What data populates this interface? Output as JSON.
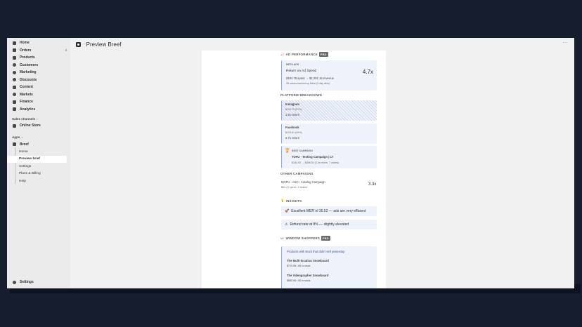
{
  "sidebar": {
    "nav": [
      {
        "label": "Home",
        "icon": "home-icon"
      },
      {
        "label": "Orders",
        "icon": "orders-icon",
        "badge": "4"
      },
      {
        "label": "Products",
        "icon": "products-icon"
      },
      {
        "label": "Customers",
        "icon": "customers-icon"
      },
      {
        "label": "Marketing",
        "icon": "marketing-icon"
      },
      {
        "label": "Discounts",
        "icon": "discounts-icon"
      },
      {
        "label": "Content",
        "icon": "content-icon"
      },
      {
        "label": "Markets",
        "icon": "markets-icon"
      },
      {
        "label": "Finance",
        "icon": "finance-icon"
      },
      {
        "label": "Analytics",
        "icon": "analytics-icon"
      }
    ],
    "sales_channels_label": "Sales channels",
    "online_store": "Online Store",
    "apps_label": "Apps",
    "app_name": "Breef",
    "app_subitems": [
      "Home",
      "Preview brief",
      "Settings",
      "Plans & Billing",
      "Help"
    ],
    "settings": "Settings"
  },
  "header": {
    "title": "Preview Breef",
    "more": "···"
  },
  "report": {
    "ad_performance": {
      "label": "AD PERFORMANCE",
      "badge": "PRO"
    },
    "meta": {
      "tag": "META ADS",
      "title": "Return on Ad Spend",
      "value": "4.7x",
      "line1": "$184.76 spent → $1,251.16 revenue",
      "line2": "35 orders tracked by Meta (1-day click)"
    },
    "platform_label": "PLATFORM BREAKDOWN",
    "instagram": {
      "name": "Instagram",
      "spend": "$104.75 (57%)",
      "ret": "1.6x return"
    },
    "facebook": {
      "name": "Facebook",
      "spend": "$124.81 (49%)",
      "ret": "2.7x return"
    },
    "best": {
      "label": "BEST CAMPAIGN",
      "name": "TOFU - Testing Campaign | LT",
      "line": "$184.53 → $468.60 (3.4x return, 7 orders)"
    },
    "other_label": "OTHER CAMPAIGNS",
    "other": {
      "name": "MOFU - ASC+ Catalog Campaign",
      "line": "$61.22 spent • 2 orders",
      "value": "3.3x"
    },
    "insights_label": "INSIGHTS",
    "insight1": "Excellent MER of 35.52 — ads are very efficient",
    "insight2": "Refund rate at 8% — slightly elevated",
    "window_label": "WINDOW SHOPPERS",
    "window_badge": "PRO",
    "window": {
      "title": "Products with stock that didn't sell yesterday:",
      "p1": "The Multi-location Snowboard",
      "p1s": "$729.95 • 89 in stock",
      "p2": "The Videographer Snowboard",
      "p2s": "$885.95 • 50 in stock"
    }
  }
}
